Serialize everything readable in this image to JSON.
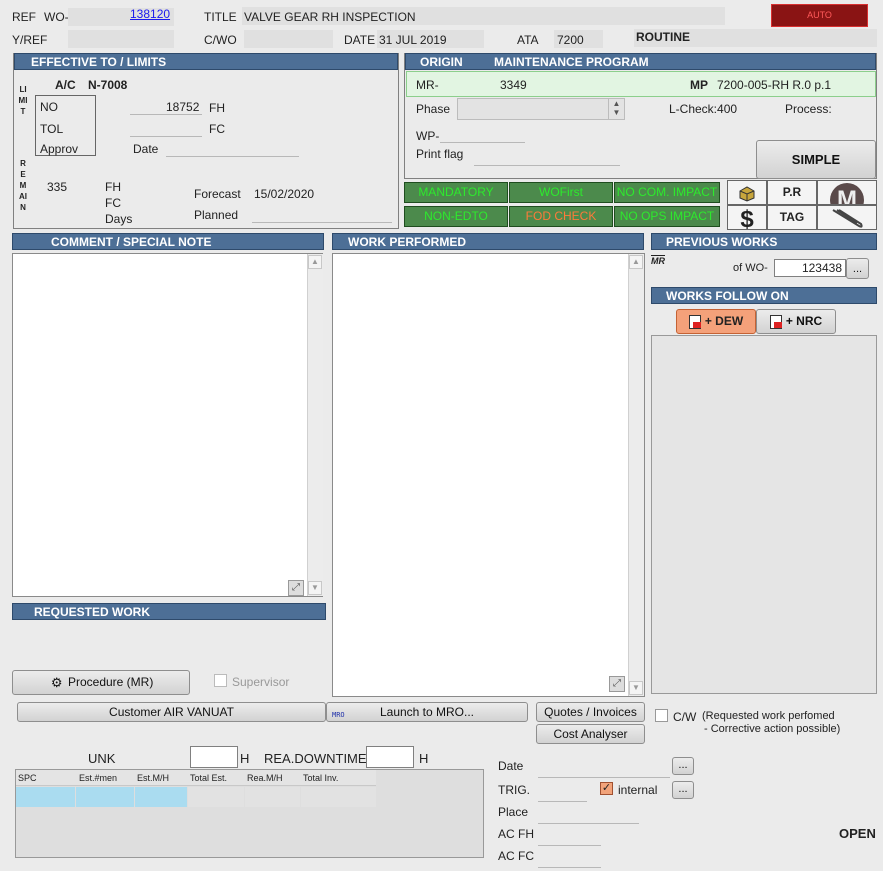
{
  "header": {
    "ref_label": "REF",
    "wo_label": "WO-",
    "wo_number": "138120",
    "title_label": "TITLE",
    "title_value": "VALVE GEAR RH INSPECTION",
    "auto_button": "AUTO",
    "yref_label": "Y/REF",
    "cwo_label": "C/WO",
    "date_label": "DATE",
    "date_value": "31 JUL 2019",
    "ata_label": "ATA",
    "ata_value": "7200",
    "routine_label": "ROUTINE"
  },
  "effective": {
    "header": "EFFECTIVE TO / LIMITS",
    "limit_letters": "LIMIT",
    "remain_letters": "REMAIN",
    "ac_label": "A/C",
    "ac_value": "N-7008",
    "no_label": "NO",
    "tol_label": "TOL",
    "approv_label": "Approv",
    "no_value": "18752",
    "fh_label": "FH",
    "fc_label": "FC",
    "date_label": "Date",
    "remain_value": "335",
    "remain_fh": "FH",
    "remain_fc": "FC",
    "remain_days": "Days",
    "forecast_label": "Forecast",
    "forecast_value": "15/02/2020",
    "planned_label": "Planned"
  },
  "origin": {
    "header": "ORIGIN",
    "program": "MAINTENANCE PROGRAM",
    "mr_label": "MR-",
    "mr_value": "3349",
    "mp_label": "MP",
    "mp_value": "7200-005-RH R.0 p.1",
    "phase_label": "Phase",
    "lcheck_label": "L-Check:400",
    "process_label": "Process:",
    "wp_label": "WP-",
    "printflag_label": "Print flag",
    "simple_button": "SIMPLE"
  },
  "flags": [
    "MANDATORY",
    "WOFirst",
    "NO COM. IMPACT",
    "NON-EDTO",
    "FOD CHECK",
    "NO OPS IMPACT"
  ],
  "icons": {
    "pr_label": "P.R",
    "tag_label": "TAG",
    "m_label": "M",
    "dollar_label": "$"
  },
  "comment": {
    "header": "COMMENT / SPECIAL NOTE"
  },
  "work_performed": {
    "header": "WORK PERFORMED"
  },
  "previous": {
    "header": "PREVIOUS WORKS",
    "of_wo_label": "of WO-",
    "of_wo_value": "123438",
    "mr_icon_label": "MR",
    "dots": "..."
  },
  "follow": {
    "header": "WORKS FOLLOW ON",
    "dew_button": "+ DEW",
    "nrc_button": "+ NRC"
  },
  "requested": {
    "header": "REQUESTED WORK",
    "procedure_button": "Procedure (MR)",
    "supervisor_label": "Supervisor"
  },
  "bottom": {
    "customer_button": "Customer AIR VANUAT",
    "launch_button": "Launch to MRO...",
    "mro_icon_label": "MRO",
    "quotes_button": "Quotes / Invoices",
    "cost_button": "Cost Analyser",
    "cw_label": "C/W",
    "cw_note1": "(Requested work perfomed",
    "cw_note2": "- Corrective action possible)",
    "unk_label": "UNK",
    "h1": "H",
    "rea_label": "REA.DOWNTIME",
    "h2": "H",
    "date_label": "Date",
    "trig_label": "TRIG.",
    "internal_label": "internal",
    "place_label": "Place",
    "acfh_label": "AC FH",
    "acfc_label": "AC FC",
    "status": "OPEN",
    "dots": "..."
  },
  "table": {
    "columns": [
      "SPC",
      "Est.#men",
      "Est.M/H",
      "Total Est.",
      "Rea.M/H",
      "Total Inv."
    ]
  }
}
